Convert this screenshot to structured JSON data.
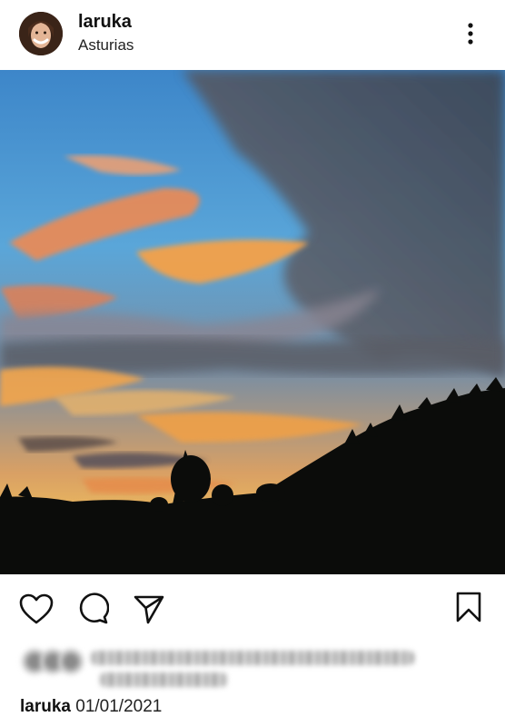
{
  "post": {
    "username": "laruka",
    "location": "Asturias",
    "caption_user": "laruka",
    "caption_date": "01/01/2021"
  },
  "icons": {
    "more": "more-vertical-icon",
    "like": "heart-icon",
    "comment": "comment-icon",
    "share": "send-icon",
    "save": "bookmark-icon"
  },
  "colors": {
    "sky_blue": "#4f9bd3",
    "cloud_orange": "#f39a52",
    "silhouette": "#0b0c0a"
  }
}
